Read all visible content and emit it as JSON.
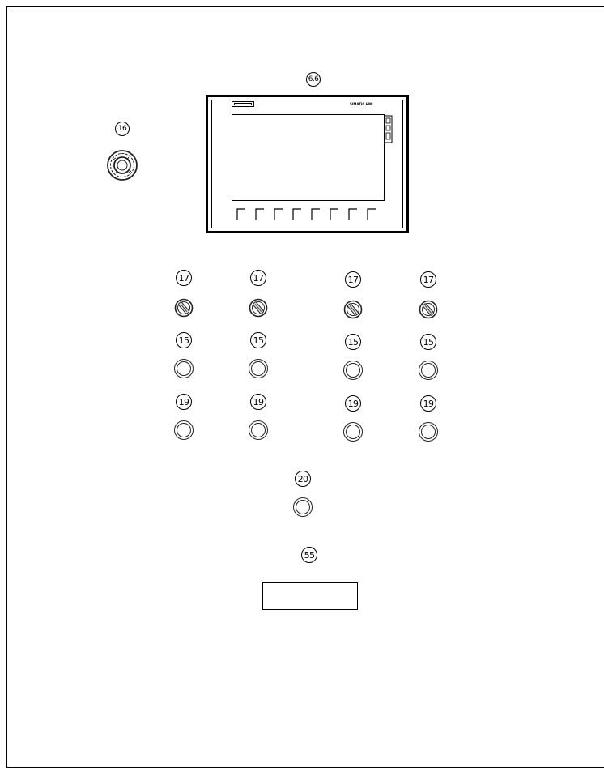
{
  "drawing": {
    "hmi": {
      "callout": "6.6",
      "brand_text": "SIMATIC HMI",
      "softkey_count": 8
    },
    "emergency_stop": {
      "callout": "16"
    },
    "columns": [
      {
        "selector_callout": "17",
        "lamp_callout": "15",
        "button_callout": "19"
      },
      {
        "selector_callout": "17",
        "lamp_callout": "15",
        "button_callout": "19"
      },
      {
        "selector_callout": "17",
        "lamp_callout": "15",
        "button_callout": "19"
      },
      {
        "selector_callout": "17",
        "lamp_callout": "15",
        "button_callout": "19"
      }
    ],
    "center_button": {
      "callout": "20"
    },
    "label_plate": {
      "callout": "55"
    }
  }
}
